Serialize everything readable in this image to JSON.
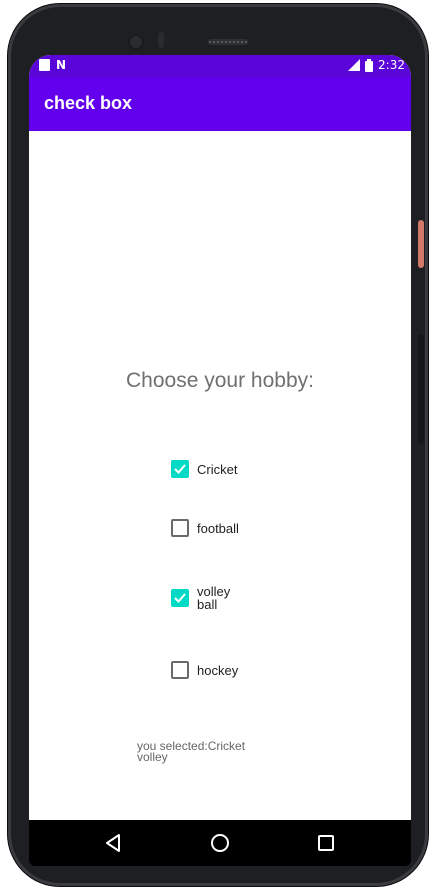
{
  "status_bar": {
    "time": "2:32",
    "icons": [
      "sim-card-icon",
      "n-notification-icon",
      "signal-icon",
      "battery-icon"
    ]
  },
  "app_bar": {
    "title": "check box"
  },
  "main": {
    "heading": "Choose your hobby:",
    "checkboxes": [
      {
        "label": "Cricket",
        "checked": true
      },
      {
        "label": "football",
        "checked": false
      },
      {
        "label": "volley\nball",
        "checked": true
      },
      {
        "label": "hockey",
        "checked": false
      }
    ],
    "result_text": "you selected:Cricket volley"
  },
  "nav_bar": {
    "buttons": [
      "back-icon",
      "home-icon",
      "recents-icon"
    ]
  },
  "colors": {
    "status_bar": "#5b06d8",
    "app_bar": "#6200ee",
    "checkbox_checked": "#03dac5"
  }
}
